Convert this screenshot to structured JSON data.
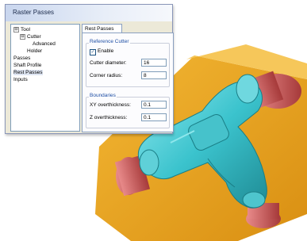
{
  "window": {
    "title": "Raster Passes"
  },
  "tree": {
    "items": [
      {
        "label": "Tool",
        "expander": "⊟"
      },
      {
        "label": "Cutter",
        "expander": "⊟"
      },
      {
        "label": "Advanced",
        "expander": ""
      },
      {
        "label": "Holder",
        "expander": ""
      },
      {
        "label": "Passes",
        "expander": ""
      },
      {
        "label": "Shaft Profile",
        "expander": ""
      },
      {
        "label": "Rest Passes",
        "expander": ""
      },
      {
        "label": "Inputs",
        "expander": ""
      }
    ]
  },
  "tab": {
    "label": "Rest Passes"
  },
  "reference_cutter": {
    "title": "Reference Cutter",
    "enable_label": "Enable",
    "enable_checked": "✓",
    "diameter_label": "Cutter diameter:",
    "diameter_value": "16",
    "radius_label": "Corner radius:",
    "radius_value": "8"
  },
  "boundaries": {
    "title": "Boundaries",
    "xy_label": "XY overthickness:",
    "xy_value": "0.1",
    "z_label": "Z overthickness:",
    "z_value": "0.1"
  },
  "colors": {
    "stock": "#e8a81a",
    "part": "#3cc6cf",
    "pipe_end": "#c85858"
  }
}
